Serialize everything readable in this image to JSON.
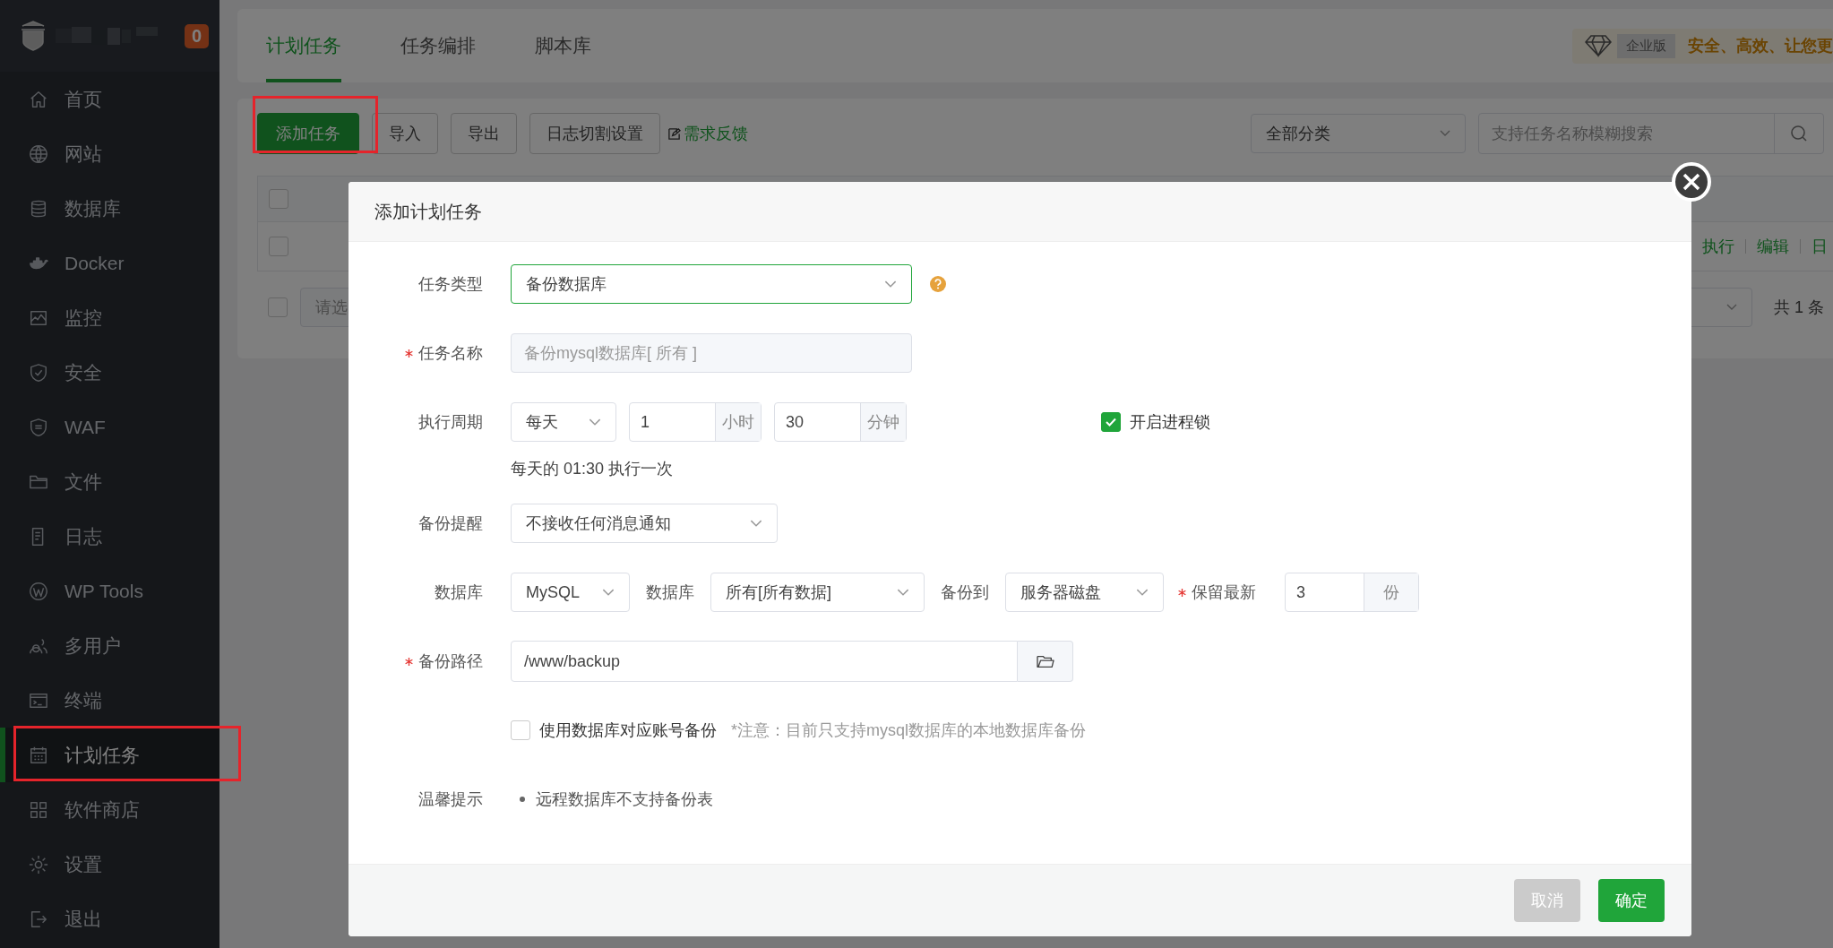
{
  "brand": {
    "badge": "0"
  },
  "sidebar": {
    "items": [
      {
        "label": "首页",
        "selected": false
      },
      {
        "label": "网站",
        "selected": false
      },
      {
        "label": "数据库",
        "selected": false
      },
      {
        "label": "Docker",
        "selected": false
      },
      {
        "label": "监控",
        "selected": false
      },
      {
        "label": "安全",
        "selected": false
      },
      {
        "label": "WAF",
        "selected": false
      },
      {
        "label": "文件",
        "selected": false
      },
      {
        "label": "日志",
        "selected": false
      },
      {
        "label": "WP Tools",
        "selected": false
      },
      {
        "label": "多用户",
        "selected": false
      },
      {
        "label": "终端",
        "selected": false
      },
      {
        "label": "计划任务",
        "selected": true,
        "highlighted": true
      },
      {
        "label": "软件商店",
        "selected": false
      },
      {
        "label": "设置",
        "selected": false
      },
      {
        "label": "退出",
        "selected": false
      }
    ]
  },
  "tabs": [
    {
      "label": "计划任务",
      "selected": true
    },
    {
      "label": "任务编排",
      "selected": false
    },
    {
      "label": "脚本库",
      "selected": false
    }
  ],
  "banner": {
    "tag": "企业版",
    "slogan": "安全、高效、让您更"
  },
  "toolbar": {
    "buttons": [
      {
        "label": "添加任务",
        "kind": "primary",
        "highlighted": true
      },
      {
        "label": "导入",
        "kind": "default"
      },
      {
        "label": "导出",
        "kind": "default"
      },
      {
        "label": "日志切割设置",
        "kind": "default"
      }
    ],
    "feedback": "需求反馈",
    "category": "全部分类",
    "search_placeholder": "支持任务名称模糊搜索"
  },
  "table": {
    "select_all_checked": false,
    "rows": [
      {
        "checked": false,
        "actions": [
          "执行",
          "编辑",
          "日"
        ]
      }
    ],
    "batch_checked": false,
    "batch_placeholder": "请选",
    "total": "共 1 条"
  },
  "dialog": {
    "title": "添加计划任务",
    "task_type": {
      "label": "任务类型",
      "value": "备份数据库"
    },
    "task_name": {
      "label": "任务名称",
      "required": true,
      "value": "备份mysql数据库[ 所有 ]",
      "disabled": true
    },
    "period": {
      "label": "执行周期",
      "cycle": "每天",
      "hour": "1",
      "hour_unit": "小时",
      "minute": "30",
      "minute_unit": "分钟",
      "hint": "每天的 01:30 执行一次"
    },
    "lock": {
      "label": "开启进程锁",
      "checked": true
    },
    "notify": {
      "label": "备份提醒",
      "value": "不接收任何消息通知"
    },
    "database": {
      "label": "数据库",
      "type": "MySQL",
      "db_label": "数据库",
      "db": "所有[所有数据]",
      "target_label": "备份到",
      "target": "服务器磁盘",
      "keep_label": "保留最新",
      "keep_required": true,
      "keep": "3",
      "keep_unit": "份"
    },
    "path": {
      "label": "备份路径",
      "required": true,
      "value": "/www/backup"
    },
    "account": {
      "label": "使用数据库对应账号备份",
      "checked": false,
      "note": "*注意：目前只支持mysql数据库的本地数据库备份"
    },
    "tips": {
      "label": "温馨提示",
      "items": [
        "远程数据库不支持备份表"
      ]
    },
    "buttons": [
      {
        "label": "取消",
        "kind": "cancel"
      },
      {
        "label": "确定",
        "kind": "confirm"
      }
    ]
  }
}
